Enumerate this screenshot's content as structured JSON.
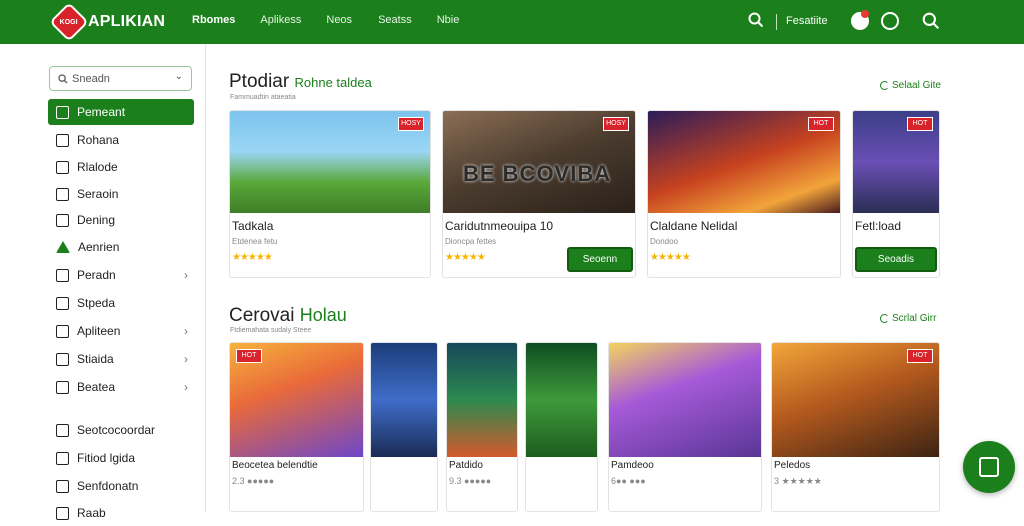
{
  "header": {
    "logo_badge": "KOGI",
    "logo_text": "APLIKIAN",
    "nav": [
      "Rbomes",
      "Aplikess",
      "Neos",
      "Seatss",
      "Nbie"
    ],
    "right_link": "Fesatiite"
  },
  "sidebar": {
    "search_placeholder": "Sneadn",
    "items": [
      {
        "label": "Pemeant",
        "active": true
      },
      {
        "label": "Rohana"
      },
      {
        "label": "Rlalode"
      },
      {
        "label": "Seraoin"
      },
      {
        "label": "Dening"
      },
      {
        "label": "Aenrien"
      },
      {
        "label": "Peradn"
      },
      {
        "label": "Stpeda"
      },
      {
        "label": "Apliteen"
      },
      {
        "label": "Stiaida"
      },
      {
        "label": "Beatea"
      },
      {
        "label": "Seotcocoordar"
      },
      {
        "label": "Fitiod lgida"
      },
      {
        "label": "Senfdonatn"
      },
      {
        "label": "Raab"
      }
    ]
  },
  "section1": {
    "title": "Ptodiar",
    "accent": "Rohne taldea",
    "subtitle": "Fammuadtin ataeatia",
    "see_all": "Selaal Gite",
    "cards": [
      {
        "name": "Tadkala",
        "meta": "Etdenea fetu",
        "stars": "★★★★★",
        "tag": "HOSY"
      },
      {
        "name": "Caridutnmeouipa 10",
        "meta": "Dioncpa fettes",
        "stars": "★★★★★",
        "button": "Seoenn",
        "tag": "HOSY",
        "art": "BE BCOVIBA"
      },
      {
        "name": "Claldane Nelidal",
        "meta": "Dondoo",
        "stars": "★★★★★",
        "tag": "HOT"
      },
      {
        "name": "Fetl:load",
        "button": "Seoadis",
        "tag": "HOT"
      }
    ]
  },
  "section2": {
    "title": "Cerovai",
    "accent": "Holau",
    "subtitle": "Ftdiemahata sudaly Steee",
    "see_all": "Scrlal Girr",
    "cards": [
      {
        "name": "Beocetea belendtie",
        "meta": "2.3 ●●●●●",
        "tag": "HOT"
      },
      {
        "name": ""
      },
      {
        "name": "Patdido",
        "meta": "9.3 ●●●●●"
      },
      {
        "name": ""
      },
      {
        "name": "Pamdeoo",
        "meta": "6●● ●●●"
      },
      {
        "name": "Peledos",
        "meta": "3 ★★★★★",
        "tag": "HOT"
      }
    ]
  }
}
